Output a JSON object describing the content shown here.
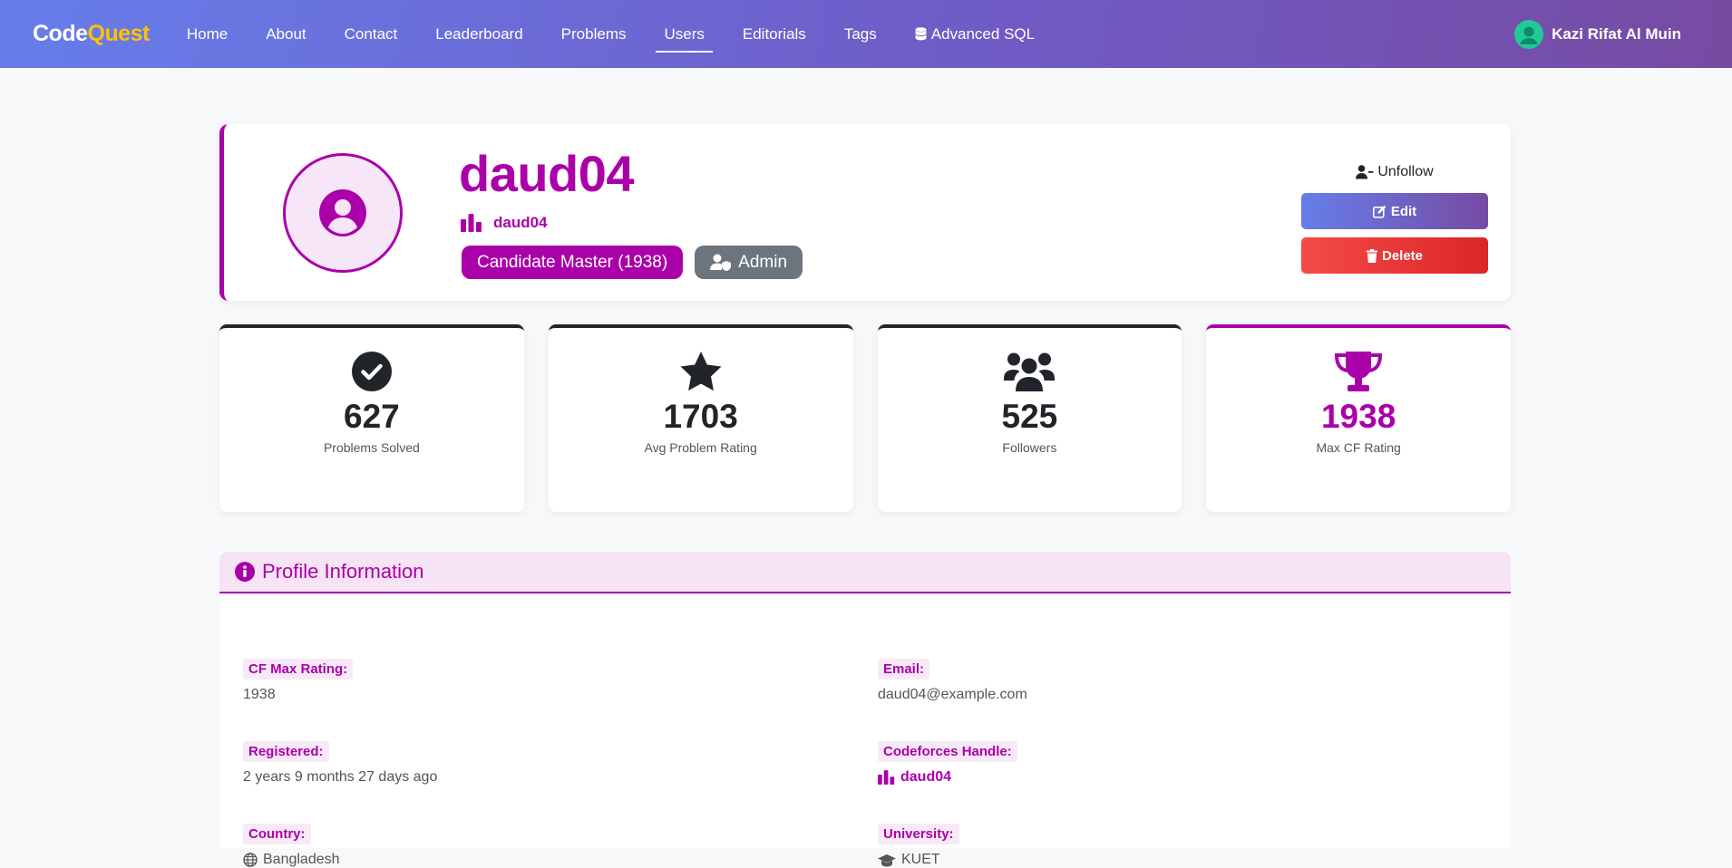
{
  "nav": {
    "brand_part1": "Code",
    "brand_part2": "Quest",
    "links": [
      {
        "label": "Home"
      },
      {
        "label": "About"
      },
      {
        "label": "Contact"
      },
      {
        "label": "Leaderboard"
      },
      {
        "label": "Problems"
      },
      {
        "label": "Users",
        "active": true
      },
      {
        "label": "Editorials"
      },
      {
        "label": "Tags"
      },
      {
        "label": "Advanced SQL",
        "icon": "database-icon"
      }
    ],
    "user_name": "Kazi Rifat Al Muin"
  },
  "profile": {
    "username": "daud04",
    "handle": "daud04",
    "rank_badge": "Candidate Master (1938)",
    "role_badge": "Admin",
    "accent_color": "#aa00aa",
    "actions": {
      "unfollow": "Unfollow",
      "edit": "Edit",
      "delete": "Delete"
    }
  },
  "stats": [
    {
      "value": "627",
      "label": "Problems Solved",
      "icon": "check-circle-icon"
    },
    {
      "value": "1703",
      "label": "Avg Problem Rating",
      "icon": "star-icon"
    },
    {
      "value": "525",
      "label": "Followers",
      "icon": "users-icon"
    },
    {
      "value": "1938",
      "label": "Max CF Rating",
      "icon": "trophy-icon"
    }
  ],
  "info": {
    "title": "Profile Information",
    "fields": {
      "cf_max_rating": {
        "label": "CF Max Rating:",
        "value": "1938"
      },
      "email": {
        "label": "Email:",
        "value": "daud04@example.com"
      },
      "registered": {
        "label": "Registered:",
        "value": "2 years 9 months 27 days ago"
      },
      "cf_handle": {
        "label": "Codeforces Handle:",
        "value": "daud04"
      },
      "country": {
        "label": "Country:",
        "value": "Bangladesh"
      },
      "university": {
        "label": "University:",
        "value": "KUET"
      }
    }
  }
}
